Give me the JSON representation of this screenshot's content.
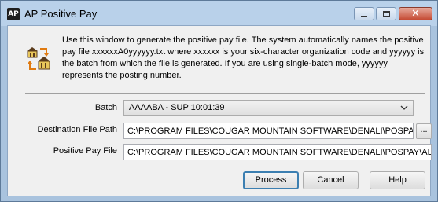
{
  "window": {
    "app_icon_text": "AP",
    "title": "AP Positive Pay",
    "controls": {
      "minimize": "minimize-icon",
      "maximize": "maximize-icon",
      "close": "✕"
    }
  },
  "info": {
    "icon": "file-transfer-icon",
    "text": "Use this window to generate the positive pay file.  The system automatically names the positive pay file xxxxxxA0yyyyyy.txt where xxxxxx is your six-character organization code and yyyyyy is the batch from which the file is generated.  If you are using single-batch mode, yyyyyy represents the posting number."
  },
  "form": {
    "batch_label": "Batch",
    "batch_value": "AAAABA - SUP 10:01:39",
    "dest_label": "Destination File Path",
    "dest_value": "C:\\PROGRAM FILES\\COUGAR MOUNTAIN SOFTWARE\\DENALI\\POSPAY\\",
    "browse_label": "...",
    "ppf_label": "Positive Pay File",
    "ppf_value": "C:\\PROGRAM FILES\\COUGAR MOUNTAIN SOFTWARE\\DENALI\\POSPAY\\ALLBO"
  },
  "buttons": {
    "process": "Process",
    "cancel": "Cancel",
    "help": "Help"
  }
}
